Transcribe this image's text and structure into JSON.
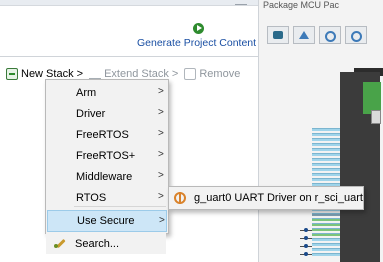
{
  "generate": {
    "label": "Generate Project Content",
    "icon": "play-icon"
  },
  "stack_toolbar": {
    "new_stack": "New Stack >",
    "extend_stack": "Extend Stack >",
    "remove": "Remove"
  },
  "menu": {
    "items": [
      {
        "label": "Arm",
        "arrow": ">"
      },
      {
        "label": "Driver",
        "arrow": ">"
      },
      {
        "label": "FreeRTOS",
        "arrow": ">"
      },
      {
        "label": "FreeRTOS+",
        "arrow": ">"
      },
      {
        "label": "Middleware",
        "arrow": ">"
      },
      {
        "label": "RTOS",
        "arrow": ">"
      },
      {
        "label": "Use Secure",
        "arrow": ">"
      },
      {
        "label": "Search..."
      }
    ],
    "selected": "Use Secure"
  },
  "submenu": {
    "items": [
      {
        "label": "g_uart0 UART Driver on r_sci_uart",
        "icon": "component-icon"
      }
    ]
  },
  "right_panel": {
    "tabs": "Package   MCU Pac"
  },
  "colors": {
    "link": "#1a4fa3",
    "selection": "#cde6f7",
    "menu_bg": "#f2f2f2"
  }
}
